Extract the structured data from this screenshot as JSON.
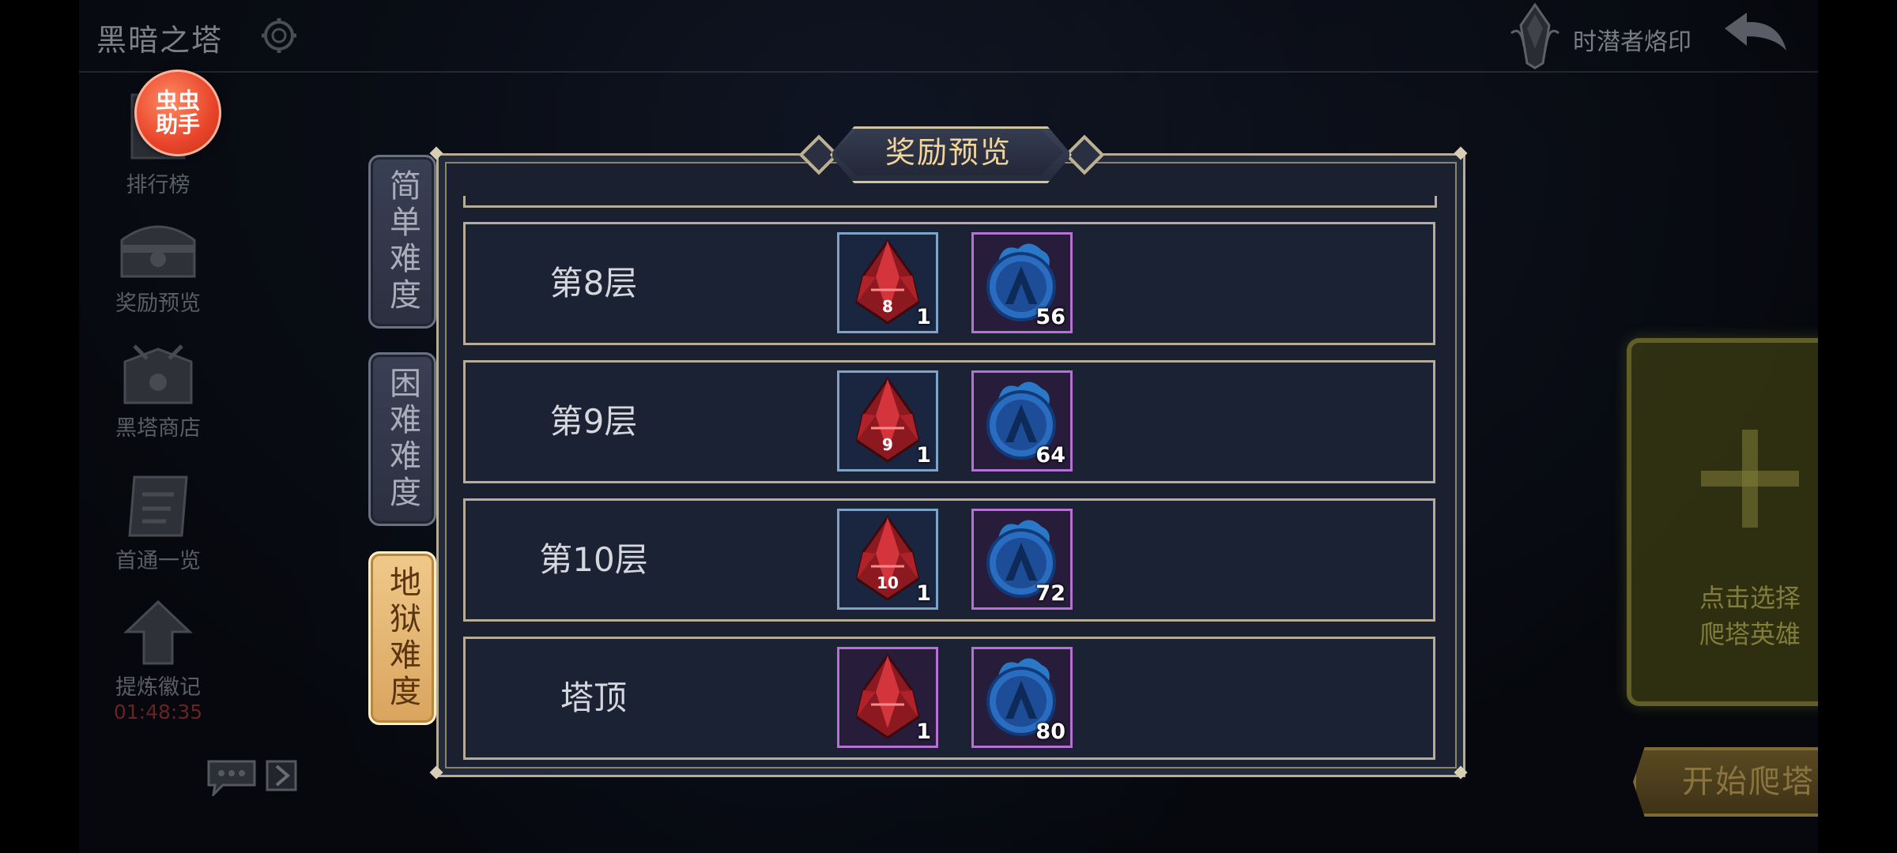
{
  "header": {
    "title": "黑暗之塔",
    "emblem_label": "时潜者烙印"
  },
  "assistant_badge": {
    "line1": "虫虫",
    "line2": "助手"
  },
  "sidebar": {
    "items": [
      {
        "label": "排行榜"
      },
      {
        "label": "奖励预览"
      },
      {
        "label": "黑塔商店"
      },
      {
        "label": "首通一览"
      },
      {
        "label": "提炼徽记"
      }
    ],
    "timer": "01:48:35"
  },
  "tabs": [
    {
      "label": "简单难度",
      "active": false
    },
    {
      "label": "困难难度",
      "active": false
    },
    {
      "label": "地狱难度",
      "active": true
    }
  ],
  "panel": {
    "title": "奖励预览",
    "rows": [
      {
        "label": "第8层",
        "items": [
          {
            "icon": "red-tower-crystal-icon",
            "badge": "8",
            "count": "1",
            "frame": "blue"
          },
          {
            "icon": "blue-flame-orb-icon",
            "count": "56",
            "frame": "purple"
          }
        ]
      },
      {
        "label": "第9层",
        "items": [
          {
            "icon": "red-tower-crystal-icon",
            "badge": "9",
            "count": "1",
            "frame": "blue"
          },
          {
            "icon": "blue-flame-orb-icon",
            "count": "64",
            "frame": "purple"
          }
        ]
      },
      {
        "label": "第10层",
        "items": [
          {
            "icon": "red-tower-crystal-icon",
            "badge": "10",
            "count": "1",
            "frame": "blue"
          },
          {
            "icon": "blue-flame-orb-icon",
            "count": "72",
            "frame": "purple"
          }
        ]
      },
      {
        "label": "塔顶",
        "items": [
          {
            "icon": "red-tower-crystal-icon",
            "badge": "",
            "count": "1",
            "frame": "purple"
          },
          {
            "icon": "blue-flame-orb-icon",
            "count": "80",
            "frame": "purple"
          }
        ]
      }
    ]
  },
  "hero_slot": {
    "line1": "点击选择",
    "line2": "爬塔英雄"
  },
  "start_button": {
    "label": "开始爬塔"
  },
  "colors": {
    "accent_gold": "#f1d59a",
    "active_tab": "#d9a45e",
    "frame_blue": "#7da3c8",
    "frame_purple": "#b472d3"
  }
}
